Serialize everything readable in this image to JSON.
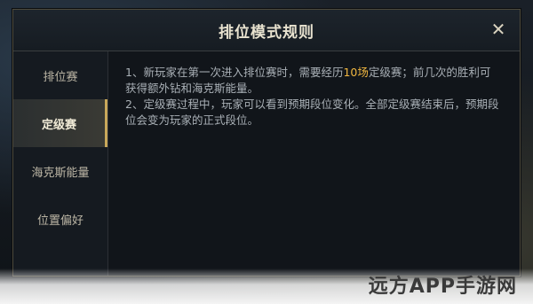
{
  "dialog": {
    "title": "排位模式规则",
    "close_symbol": "✕"
  },
  "sidebar": {
    "items": [
      {
        "label": "排位赛",
        "active": false
      },
      {
        "label": "定级赛",
        "active": true
      },
      {
        "label": "海克斯能量",
        "active": false
      },
      {
        "label": "位置偏好",
        "active": false
      }
    ]
  },
  "content": {
    "p1_before": "1、新玩家在第一次进入排位赛时，需要经历",
    "p1_highlight": "10场",
    "p1_after": "定级赛；前几次的胜利可获得额外钻和海克斯能量。",
    "p2": "2、定级赛过程中，玩家可以看到预期段位变化。全部定级赛结束后，预期段位会变为玩家的正式段位。"
  },
  "watermark": "远方APP手游网",
  "colors": {
    "highlight": "#f0b640",
    "accent_gold": "#c9a85a"
  }
}
